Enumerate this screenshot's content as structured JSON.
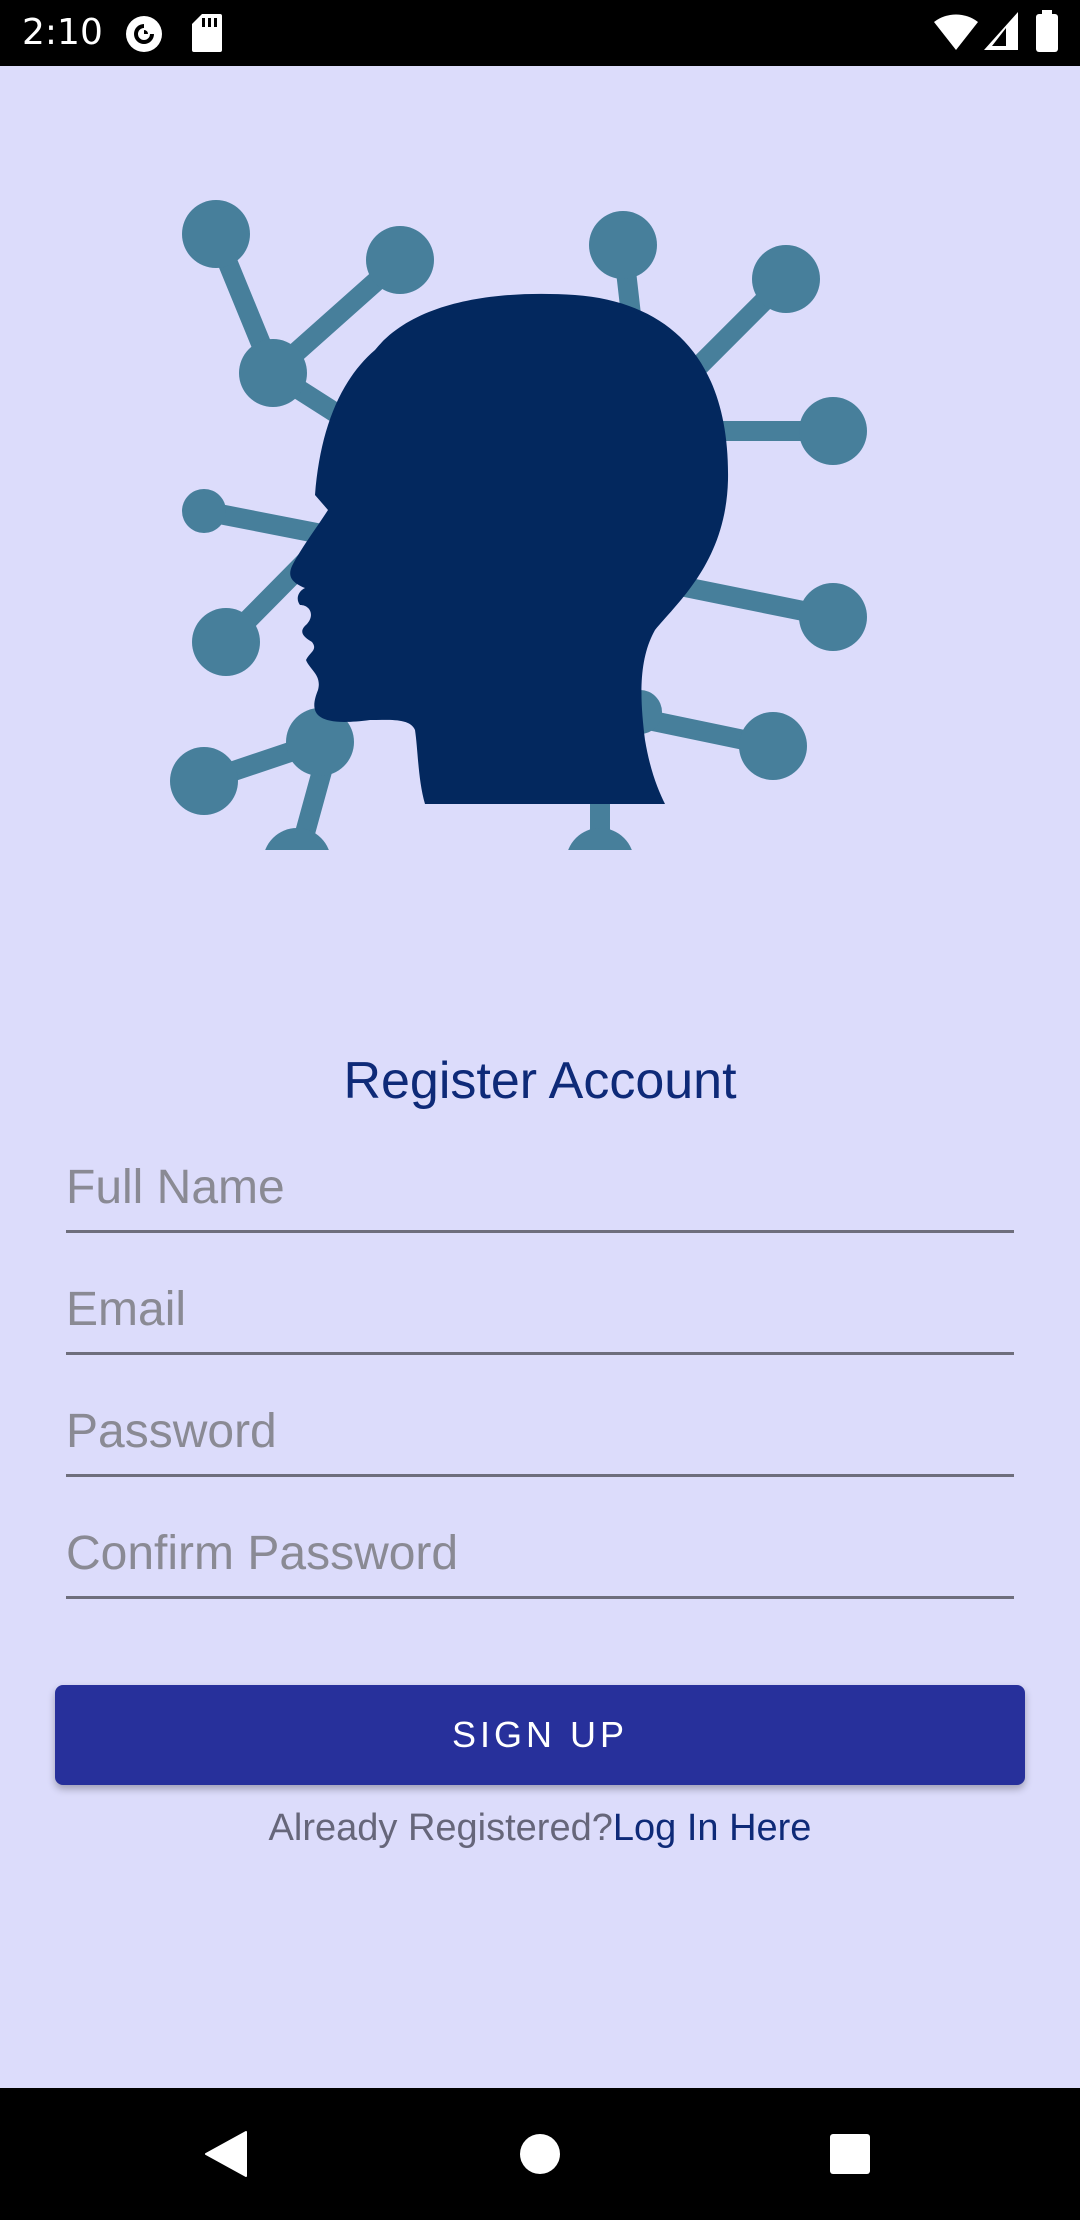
{
  "status_bar": {
    "time": "2:10",
    "icons": [
      "pocket-casts-icon",
      "sd-card-icon",
      "wifi-icon",
      "cellular-signal-icon",
      "battery-icon"
    ]
  },
  "app": {
    "logo_icon": "head-network-icon",
    "colors": {
      "background": "#dcdcfb",
      "head": "#03285e",
      "network": "#477f9b",
      "title": "#0e2a78",
      "button": "#27309b"
    }
  },
  "register": {
    "title": "Register Account",
    "full_name": {
      "value": "",
      "placeholder": "Full Name"
    },
    "email": {
      "value": "",
      "placeholder": "Email"
    },
    "password": {
      "value": "",
      "placeholder": "Password"
    },
    "confirm_password": {
      "value": "",
      "placeholder": "Confirm Password"
    },
    "signup_label": "SIGN UP",
    "already_registered": "Already Registered?",
    "login_link": "Log In Here"
  },
  "nav_bar": {
    "icons": [
      "back-icon",
      "home-icon",
      "recents-icon"
    ]
  }
}
